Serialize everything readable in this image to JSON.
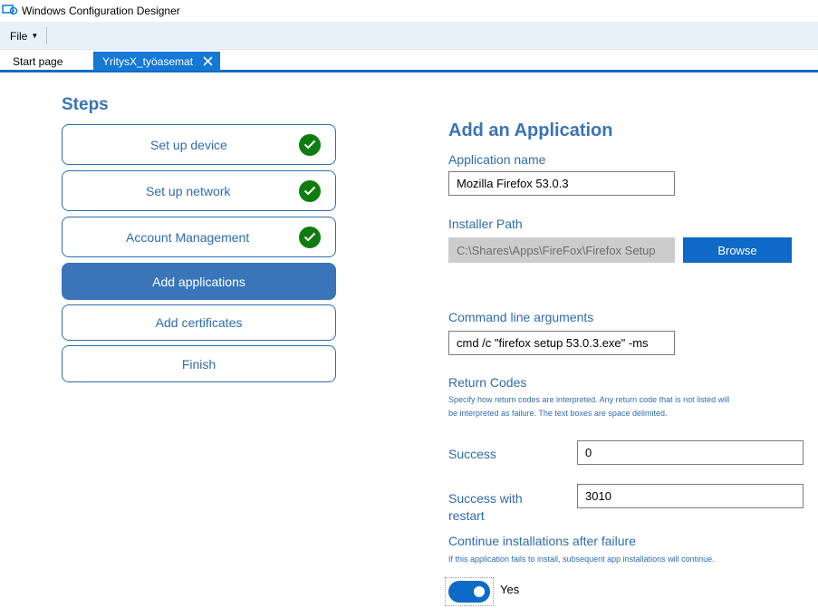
{
  "window": {
    "title": "Windows Configuration Designer"
  },
  "menu": {
    "file_label": "File"
  },
  "tabs": [
    {
      "label": "Start page"
    },
    {
      "label": "YritysX_työasemat"
    }
  ],
  "steps": {
    "title": "Steps",
    "items": [
      {
        "label": "Set up device",
        "completed": true
      },
      {
        "label": "Set up network",
        "completed": true
      },
      {
        "label": "Account Management",
        "completed": true
      },
      {
        "label": "Add applications",
        "active": true
      },
      {
        "label": "Add certificates"
      },
      {
        "label": "Finish"
      }
    ]
  },
  "form": {
    "title": "Add an Application",
    "app_name_label": "Application name",
    "app_name_value": "Mozilla Firefox 53.0.3",
    "installer_path_label": "Installer Path",
    "installer_path_value": "C:\\Shares\\Apps\\FireFox\\Firefox Setup",
    "browse_label": "Browse",
    "cmd_label": "Command line arguments",
    "cmd_value": "cmd /c \"firefox setup 53.0.3.exe\" -ms",
    "return_codes_label": "Return Codes",
    "return_codes_help_1": "Specify how return codes are interpreted. Any return code that is not listed will",
    "return_codes_help_2": "be interpreted as failure. The text boxes are space delimited.",
    "success_label": "Success",
    "success_value": "0",
    "success_restart_label_1": "Success with",
    "success_restart_label_2": "restart",
    "success_restart_value": "3010",
    "continue_label": "Continue installations after failure",
    "continue_help": "If this application fails to install, subsequent app installations will continue.",
    "continue_toggle_text": "Yes",
    "continue_toggle_on": true
  },
  "colors": {
    "accent": "#0e6ac6",
    "heading": "#3a74b4",
    "check": "#107c10"
  }
}
